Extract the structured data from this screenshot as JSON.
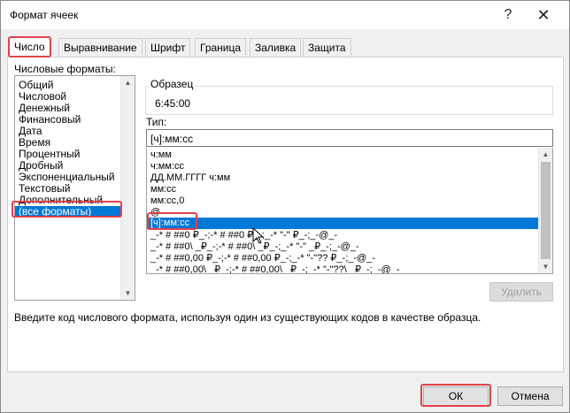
{
  "window": {
    "title": "Формат ячеек",
    "help_label": "?",
    "close_label": "✕"
  },
  "tabs": [
    {
      "label": "Число",
      "active": true
    },
    {
      "label": "Выравнивание"
    },
    {
      "label": "Шрифт"
    },
    {
      "label": "Граница"
    },
    {
      "label": "Заливка"
    },
    {
      "label": "Защита"
    }
  ],
  "categories": {
    "label": "Числовые форматы:",
    "items": [
      "Общий",
      "Числовой",
      "Денежный",
      "Финансовый",
      "Дата",
      "Время",
      "Процентный",
      "Дробный",
      "Экспоненциальный",
      "Текстовый",
      "Дополнительный",
      "(все форматы)"
    ],
    "selected_index": 11
  },
  "sample": {
    "label": "Образец",
    "value": "6:45:00"
  },
  "type": {
    "label": "Тип:",
    "value": "[ч]:мм:сс"
  },
  "formats": {
    "items": [
      "ч:мм",
      "ч:мм:сс",
      "ДД.ММ.ГГГГ ч:мм",
      "мм:сс",
      "мм:сс,0",
      "@",
      "[ч]:мм:сс",
      "_-* # ##0 ₽_-;-* # ##0 ₽_-;_-* \"-\" ₽_-;_-@_-",
      "_-* # ##0\\ _₽_-;-* # ##0\\ _₽_-;_-* \"-\" _₽_-;_-@_-",
      "_-* # ##0,00 ₽_-;-* # ##0,00 ₽_-;_-* \"-\"?? ₽_-;_-@_-",
      "_-* # ##0,00\\ _₽_-;-* # ##0,00\\ _₽_-;_-* \"-\"??\\ _₽_-;_-@_-"
    ],
    "selected_index": 6
  },
  "buttons": {
    "delete": "Удалить",
    "ok": "ОК",
    "cancel": "Отмена"
  },
  "description": "Введите код числового формата, используя один из существующих кодов в качестве образца."
}
